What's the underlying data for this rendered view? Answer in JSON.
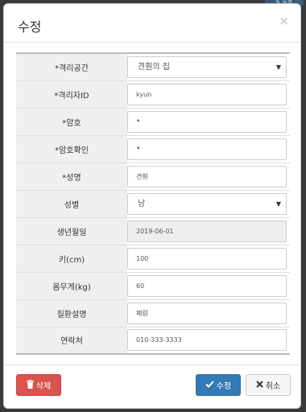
{
  "modal": {
    "title": "수정",
    "close_glyph": "×"
  },
  "form": {
    "rows": [
      {
        "label": "*격리공간",
        "type": "select",
        "value": "견훤의 집"
      },
      {
        "label": "*격리자ID",
        "type": "input",
        "value": "kyun"
      },
      {
        "label": "*암호",
        "type": "password",
        "value": "•"
      },
      {
        "label": "*암호확인",
        "type": "password",
        "value": "•"
      },
      {
        "label": "*성명",
        "type": "input",
        "value": "견훤"
      },
      {
        "label": "성별",
        "type": "select",
        "value": "남"
      },
      {
        "label": "생년월일",
        "type": "readonly",
        "value": "2019-06-01"
      },
      {
        "label": "키(cm)",
        "type": "input",
        "value": "100"
      },
      {
        "label": "몸무게(kg)",
        "type": "input",
        "value": "60"
      },
      {
        "label": "질환설명",
        "type": "input",
        "value": "폐렴"
      },
      {
        "label": "연락처",
        "type": "input",
        "value": "010-333-3333"
      }
    ]
  },
  "footer": {
    "delete_label": "삭제",
    "save_label": "수정",
    "cancel_label": "취소"
  },
  "icons": {
    "trash": "trash-icon",
    "check": "check-icon",
    "times": "times-icon"
  },
  "colors": {
    "danger": "#d9534f",
    "primary": "#337ab7",
    "default": "#f5f5f5",
    "label_bg": "#efefef"
  }
}
